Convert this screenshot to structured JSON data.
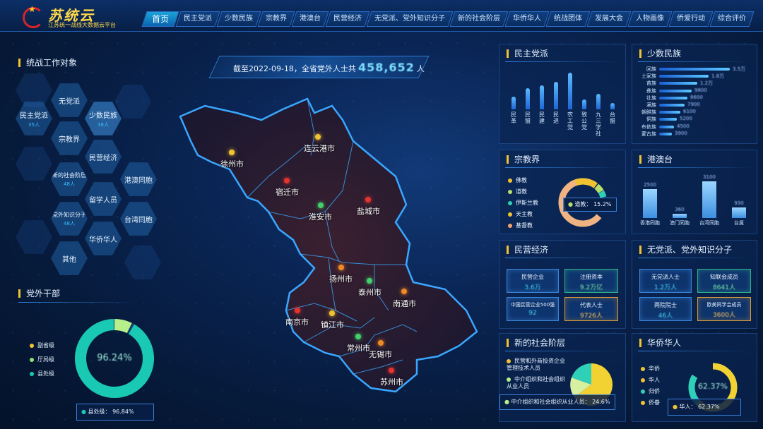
{
  "header": {
    "logo_title": "苏统云",
    "logo_subtitle": "江苏统一战线大数据云平台",
    "nav": [
      "首页",
      "民主党派",
      "少数民族",
      "宗教界",
      "港澳台",
      "民营经济",
      "无党派、党外知识分子",
      "新的社会阶层",
      "华侨华人",
      "统战团体",
      "发展大会",
      "人物画像",
      "侨爱行动",
      "综合评价"
    ]
  },
  "banner": {
    "prefix": "截至2022-09-18，全省党外人士共",
    "value": "458,652",
    "suffix": "人"
  },
  "left_top": {
    "title": "统战工作对象",
    "hexes": [
      {
        "label": "民主党派",
        "sub": "35人"
      },
      {
        "label": "无党派",
        "sub": ""
      },
      {
        "label": "少数民族",
        "sub": "38人"
      },
      {
        "label": "宗教界",
        "sub": ""
      },
      {
        "label": "民营经济",
        "sub": ""
      },
      {
        "label": "新的社会阶层",
        "sub": "48人"
      },
      {
        "label": "港澳同胞",
        "sub": ""
      },
      {
        "label": "留学人员",
        "sub": ""
      },
      {
        "label": "党外知识分子",
        "sub": "48人"
      },
      {
        "label": "台湾同胞",
        "sub": ""
      },
      {
        "label": "华侨华人",
        "sub": ""
      },
      {
        "label": "其他",
        "sub": ""
      }
    ]
  },
  "left_bottom": {
    "title": "党外干部",
    "center_value": "96.24%",
    "legend": [
      {
        "label": "副省级",
        "color": "#f1c232"
      },
      {
        "label": "厅局级",
        "color": "#8fe07a"
      },
      {
        "label": "县处级",
        "color": "#19c9b3"
      }
    ],
    "info": "县处级：  96.84%"
  },
  "map": {
    "cities": [
      {
        "name": "徐州市",
        "color": "#f1c232"
      },
      {
        "name": "连云港市",
        "color": "#f1c232"
      },
      {
        "name": "宿迁市",
        "color": "#e3342f"
      },
      {
        "name": "淮安市",
        "color": "#43d16b"
      },
      {
        "name": "盐城市",
        "color": "#e3342f"
      },
      {
        "name": "扬州市",
        "color": "#f08a24"
      },
      {
        "name": "泰州市",
        "color": "#43d16b"
      },
      {
        "name": "南通市",
        "color": "#f08a24"
      },
      {
        "name": "南京市",
        "color": "#e3342f"
      },
      {
        "name": "镇江市",
        "color": "#f1c232"
      },
      {
        "name": "常州市",
        "color": "#43d16b"
      },
      {
        "name": "无锡市",
        "color": "#f08a24"
      },
      {
        "name": "苏州市",
        "color": "#e3342f"
      }
    ]
  },
  "democratic": {
    "title": "民主党派",
    "parties": [
      {
        "label": "民革",
        "value": 28
      },
      {
        "label": "民盟",
        "value": 46
      },
      {
        "label": "民建",
        "value": 52
      },
      {
        "label": "民进",
        "value": 60
      },
      {
        "label": "农工党",
        "value": 80
      },
      {
        "label": "致公党",
        "value": 22
      },
      {
        "label": "九三学社",
        "value": 34
      },
      {
        "label": "台盟",
        "value": 14
      }
    ]
  },
  "minority": {
    "title": "少数民族",
    "rows": [
      {
        "label": "回族",
        "value": 100,
        "text": "3.5万"
      },
      {
        "label": "土家族",
        "value": 70,
        "text": "1.8万"
      },
      {
        "label": "苗族",
        "value": 54,
        "text": "1.2万"
      },
      {
        "label": "彝族",
        "value": 46,
        "text": "9800"
      },
      {
        "label": "壮族",
        "value": 40,
        "text": "8600"
      },
      {
        "label": "满族",
        "value": 36,
        "text": "7900"
      },
      {
        "label": "朝鲜族",
        "value": 30,
        "text": "6100"
      },
      {
        "label": "侗族",
        "value": 25,
        "text": "5200"
      },
      {
        "label": "布依族",
        "value": 21,
        "text": "4500"
      },
      {
        "label": "蒙古族",
        "value": 18,
        "text": "3900"
      }
    ]
  },
  "religion": {
    "title": "宗教界",
    "legend": [
      {
        "label": "佛教",
        "color": "#f1c232"
      },
      {
        "label": "道教",
        "color": "#b7e06a"
      },
      {
        "label": "伊斯兰教",
        "color": "#2fd0b8"
      },
      {
        "label": "天主教",
        "color": "#f1c232"
      },
      {
        "label": "基督教",
        "color": "#f0a36a"
      }
    ],
    "info": "道教：  15.2%"
  },
  "hmt": {
    "title": "港澳台",
    "items": [
      {
        "label": "香港同胞",
        "value": 70,
        "text": "2500"
      },
      {
        "label": "澳门同胞",
        "value": 10,
        "text": "360"
      },
      {
        "label": "台湾同胞",
        "value": 88,
        "text": "3100"
      },
      {
        "label": "台属",
        "value": 26,
        "text": "930"
      }
    ]
  },
  "private": {
    "title": "民营经济",
    "cards": [
      {
        "label": "民营企业",
        "value": "3.6万",
        "style": "blue"
      },
      {
        "label": "注册资本",
        "value": "9.2万亿",
        "style": "green"
      },
      {
        "label": "中国民营企业500强",
        "value": "92",
        "style": "blue"
      },
      {
        "label": "代表人士",
        "value": "9726人",
        "style": "orange"
      }
    ]
  },
  "nonparty": {
    "title": "无党派、党外知识分子",
    "cards": [
      {
        "label": "无党派人士",
        "value": "1.2万人",
        "style": "blue"
      },
      {
        "label": "知联会成员",
        "value": "8641人",
        "style": "green"
      },
      {
        "label": "两院院士",
        "value": "46人",
        "style": "blue"
      },
      {
        "label": "欧美同学会成员",
        "value": "3600人",
        "style": "orange"
      }
    ]
  },
  "newclass": {
    "title": "新的社会阶层",
    "legend": [
      "民营和外商投资企业管理技术人员",
      "中介组织和社会组织从业人员"
    ],
    "info": "中介组织和社会组织从业人员：  24.6%"
  },
  "overseas": {
    "title": "华侨华人",
    "center_value": "62.37%",
    "legend": [
      {
        "label": "华侨",
        "color": "#f1c232"
      },
      {
        "label": "华人",
        "color": "#f1c232"
      },
      {
        "label": "归侨",
        "color": "#2fd0b8"
      },
      {
        "label": "侨眷",
        "color": "#f1c232"
      }
    ],
    "info": "华人：  62.37%"
  }
}
